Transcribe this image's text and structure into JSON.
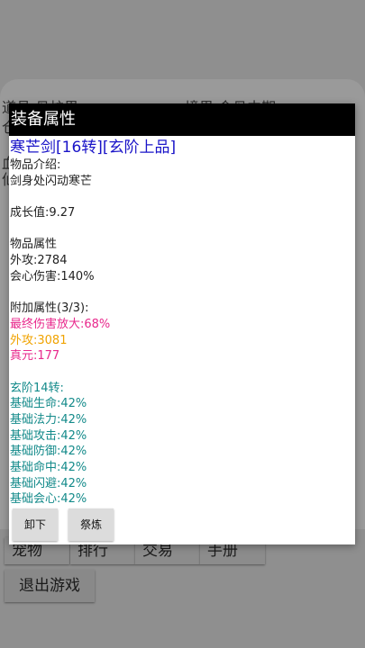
{
  "background": {
    "row1_left": "道具 丹炉界",
    "row1_right": "境界 金丹中期",
    "side_left_1": "仓",
    "side_left_2": "血",
    "side_left_3": "仙",
    "bottom_buttons": [
      "宠物",
      "排行",
      "交易",
      "手册"
    ],
    "exit_label": "退出游戏"
  },
  "dialog": {
    "title": "装备属性",
    "item_name": "寒芒剑[16转][玄阶上品]",
    "intro_label": "物品介绍:",
    "intro_text": "剑身处闪动寒芒",
    "growth": "成长值:9.27",
    "attr_heading": "物品属性",
    "attr_attack": "外攻:2784",
    "attr_crit": "会心伤害:140%",
    "extra_heading": "附加属性(3/3):",
    "extra_1": "最终伤害放大:68%",
    "extra_2": "外攻:3081",
    "extra_3": "真元:177",
    "tier_heading": "玄阶14转:",
    "tier_stats": [
      "基础生命:42%",
      "基础法力:42%",
      "基础攻击:42%",
      "基础防御:42%",
      "基础命中:42%",
      "基础闪避:42%",
      "基础会心:42%"
    ],
    "unequip_label": "卸下",
    "refine_label": "祭炼"
  },
  "colors": {
    "item_name": "#1a14c8",
    "extra_1": "#e8288c",
    "extra_2": "#f0a300",
    "extra_3": "#e8288c",
    "tier": "#138a8a"
  }
}
